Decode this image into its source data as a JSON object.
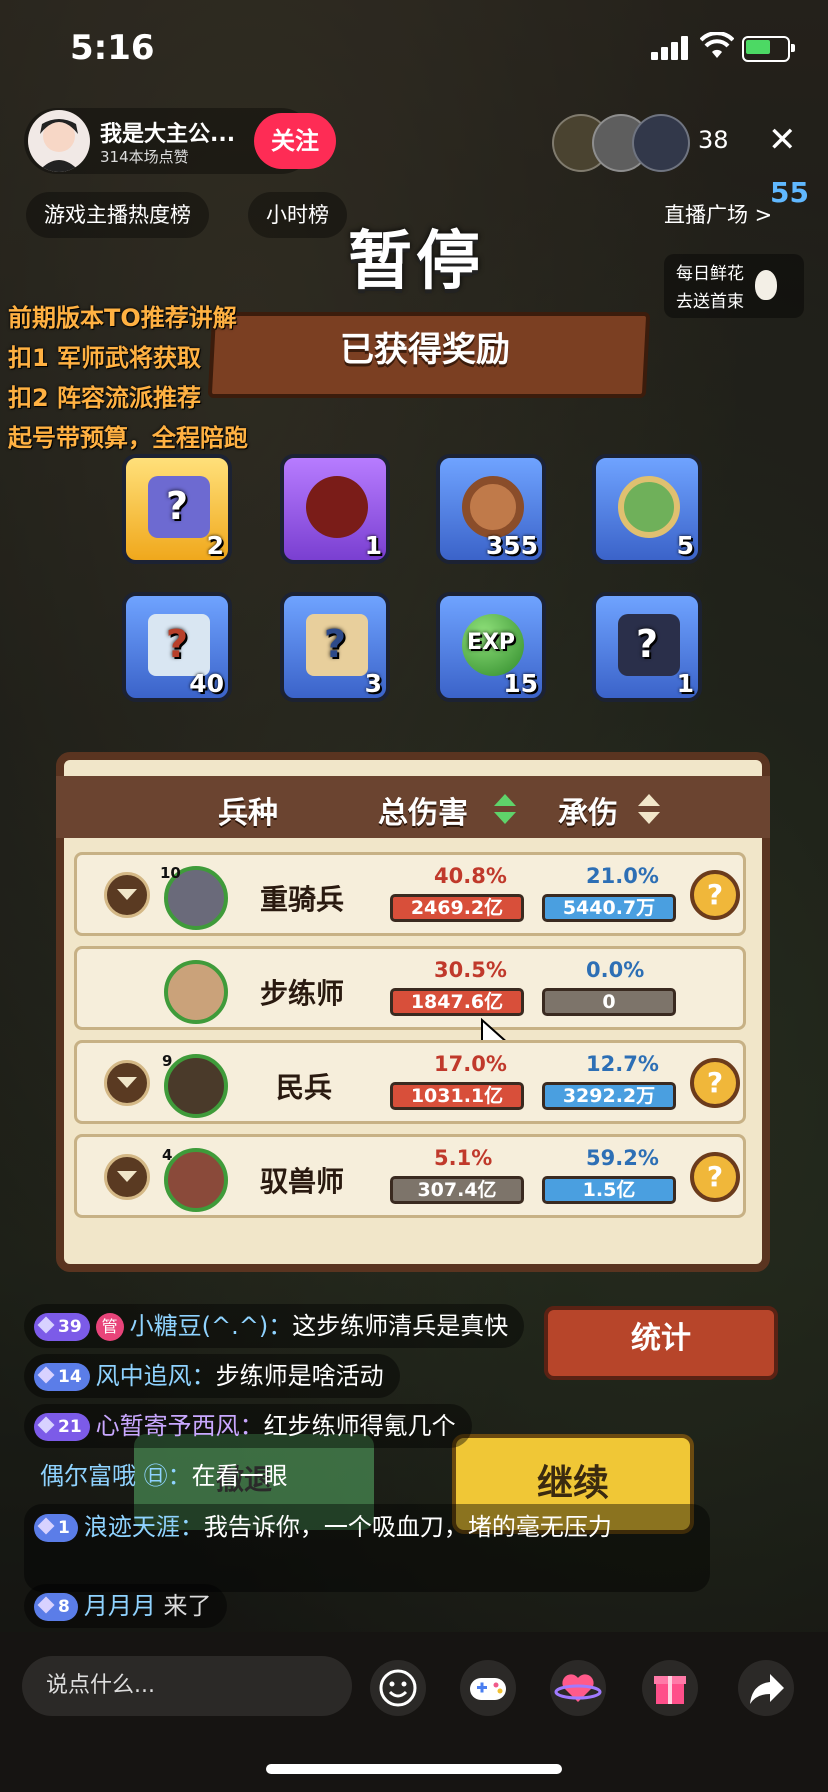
{
  "status_bar": {
    "time": "5:16"
  },
  "streamer": {
    "name": "我是大主公...",
    "likes": "314本场点赞",
    "follow_label": "关注",
    "viewer_count": "38"
  },
  "tags": {
    "hot_rank": "游戏主播热度榜",
    "hour_rank": "小时榜",
    "square": "直播广场 >",
    "badge": "55"
  },
  "flower": {
    "line1": "每日鲜花",
    "line2": "去送首束"
  },
  "promo": [
    "前期版本TO推荐讲解",
    "扣1 军师武将获取",
    "扣2 阵容流派推荐",
    "起号带预算，全程陪跑"
  ],
  "game": {
    "pause_title": "暂停",
    "reward_title": "已获得奖励",
    "rewards": [
      {
        "icon": "mystery-chest-icon",
        "count": "2"
      },
      {
        "icon": "wine-jar-icon",
        "count": "1"
      },
      {
        "icon": "copper-coin-icon",
        "count": "355"
      },
      {
        "icon": "jade-pendant-icon",
        "count": "5"
      },
      {
        "icon": "scroll-blue-icon",
        "count": "40"
      },
      {
        "icon": "scroll-tan-icon",
        "count": "3"
      },
      {
        "icon": "exp-orb-icon",
        "count": "15"
      },
      {
        "icon": "mystery-armor-icon",
        "count": "1"
      }
    ],
    "table": {
      "col_unit": "兵种",
      "col_damage": "总伤害",
      "col_taken": "承伤",
      "rows": [
        {
          "level": "10",
          "name": "重骑兵",
          "damage_pct": "40.8%",
          "damage": "2469.2亿",
          "taken_pct": "21.0%",
          "taken": "5440.7万"
        },
        {
          "level": "",
          "name": "步练师",
          "damage_pct": "30.5%",
          "damage": "1847.6亿",
          "taken_pct": "0.0%",
          "taken": "0"
        },
        {
          "level": "9",
          "name": "民兵",
          "damage_pct": "17.0%",
          "damage": "1031.1亿",
          "taken_pct": "12.7%",
          "taken": "3292.2万"
        },
        {
          "level": "4",
          "name": "驭兽师",
          "damage_pct": "5.1%",
          "damage": "307.4亿",
          "taken_pct": "59.2%",
          "taken": "1.5亿"
        }
      ]
    },
    "stats_label": "统计",
    "retreat_label": "撤退",
    "continue_label": "继续",
    "question_mark": "?"
  },
  "chat": [
    {
      "level": "39",
      "badge": "管",
      "user": "小糖豆(^.^)：",
      "text": "这步练师清兵是真快"
    },
    {
      "level": "14",
      "badge": "",
      "user": "风中追风：",
      "text": "步练师是啥活动"
    },
    {
      "level": "21",
      "badge": "",
      "user": "心暂寄予西风：",
      "text": "红步练师得氪几个"
    },
    {
      "level": "",
      "badge": "",
      "user": "偶尔富哦 ㊐：",
      "text": "在看一眼"
    },
    {
      "level": "1",
      "badge": "",
      "user": "浪迹天涯：",
      "text": "我告诉你，一个吸血刀，堵的毫无压力"
    },
    {
      "level": "8",
      "badge": "",
      "user": "月月月",
      "text": "来了"
    }
  ],
  "bottom": {
    "placeholder": "说点什么..."
  },
  "colors": {
    "follow": "#fe2c55",
    "promo": "#ffb142",
    "damage": "#d84f3a",
    "taken": "#4a9fe0"
  }
}
